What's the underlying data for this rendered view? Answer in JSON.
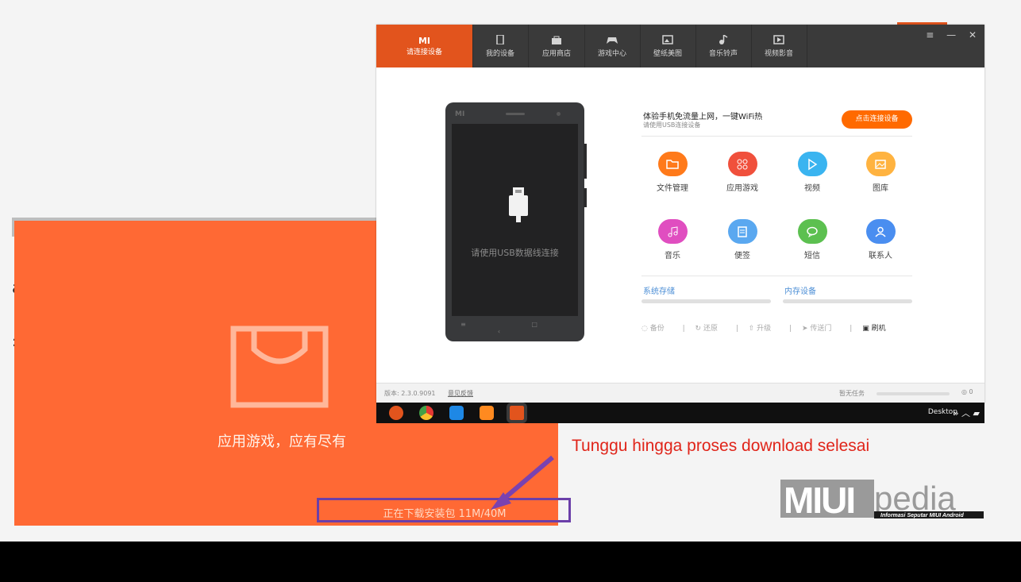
{
  "installer": {
    "title": "应用游戏，应有尽有",
    "status": "正在下载安装包 11M/40M",
    "color": "#ff6934"
  },
  "annotation": {
    "caption": "Tunggu hingga proses download selesai",
    "caption_color": "#e0251a",
    "highlight_color": "#6b3fa9"
  },
  "logo": {
    "main": "MIUI",
    "suffix": "pedia",
    "tagline": "Informasi Seputar MIUI Android"
  },
  "window": {
    "tabs": [
      {
        "label": "请连接设备",
        "brand": "MI",
        "icon": "mi-logo-icon"
      },
      {
        "label": "我的设备",
        "icon": "phone-icon"
      },
      {
        "label": "应用商店",
        "icon": "bag-icon"
      },
      {
        "label": "游戏中心",
        "icon": "gamepad-icon"
      },
      {
        "label": "壁纸美图",
        "icon": "image-icon"
      },
      {
        "label": "音乐铃声",
        "icon": "music-note-icon"
      },
      {
        "label": "视频影音",
        "icon": "video-icon"
      }
    ],
    "controls": [
      "≡",
      "—",
      "✕"
    ]
  },
  "phone": {
    "brand": "MI",
    "message": "请使用USB数据线连接",
    "keys": "≡ □ ‹"
  },
  "promo": {
    "title": "体验手机免流量上网，一键WiFi热",
    "subtitle": "请使用USB连接设备",
    "button": "点击连接设备"
  },
  "features": [
    {
      "label": "文件管理",
      "color": "#ff7a1a",
      "icon": "folder-icon"
    },
    {
      "label": "应用游戏",
      "color": "#f0503c",
      "icon": "apps-icon"
    },
    {
      "label": "视频",
      "color": "#3ab4f0",
      "icon": "play-icon"
    },
    {
      "label": "图库",
      "color": "#ffb340",
      "icon": "gallery-icon"
    },
    {
      "label": "音乐",
      "color": "#e04ec0",
      "icon": "music-icon"
    },
    {
      "label": "便签",
      "color": "#5aa8f0",
      "icon": "note-icon"
    },
    {
      "label": "短信",
      "color": "#5cc050",
      "icon": "message-icon"
    },
    {
      "label": "联系人",
      "color": "#4a8ef0",
      "icon": "contact-icon"
    }
  ],
  "storage": {
    "system": "系统存储",
    "internal": "内存设备"
  },
  "actions": [
    "备份",
    "还原",
    "升级",
    "传送门",
    "刷机"
  ],
  "statusbar": {
    "version": "版本: 2.3.0.9091",
    "feedback": "意见反馈",
    "task": "暂无任务",
    "count": "0"
  },
  "taskbar": {
    "apps": [
      {
        "name": "mi-app",
        "color": "#e2541d"
      },
      {
        "name": "chrome",
        "color": "#4caf50"
      },
      {
        "name": "blue-app",
        "color": "#1e88e5"
      },
      {
        "name": "slides-app",
        "color": "#ff8a20"
      },
      {
        "name": "mi-suite",
        "color": "#e2541d"
      }
    ],
    "desktop": "Desktop",
    "tray": "» ︿ ▰"
  }
}
